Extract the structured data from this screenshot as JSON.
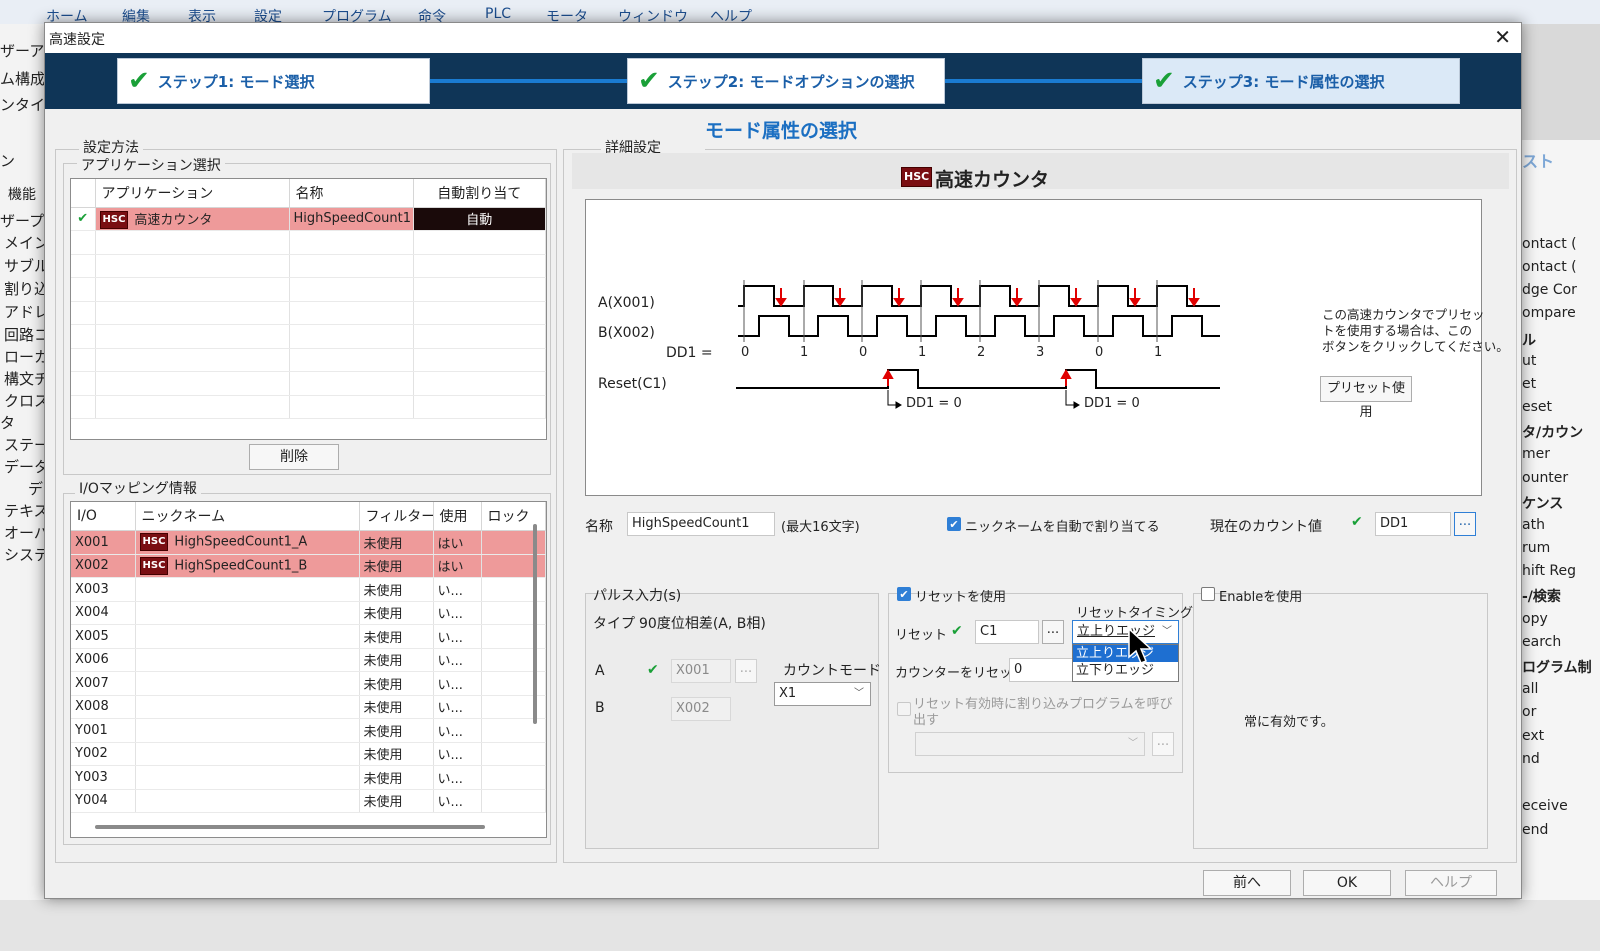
{
  "background": {
    "menu": [
      "ホーム",
      "編集",
      "表示",
      "設定",
      "プログラム",
      "命令",
      "PLC",
      "モータ",
      "ウィンドウ",
      "ヘルプ"
    ],
    "left_items": [
      "ザーアカウ",
      "ム構成",
      "ンタイム",
      "ン",
      "機能",
      "ザープロ",
      "メイン",
      "サブル",
      "割り込",
      "アドレ",
      "回路コ",
      "ローカ",
      "構文チ",
      "クロス",
      "タ",
      "ステー",
      "データ",
      "デ",
      "テキス",
      "オーバ",
      "システ"
    ],
    "right_items": [
      "スト",
      "ontact (",
      "ontact (",
      "dge Cor",
      "ompare",
      "ル",
      "ut",
      "et",
      "eset",
      "タ/カウン",
      "mer",
      "ounter",
      "ケンス",
      "ath",
      "rum",
      "hift Reg",
      "-/検索",
      "opy",
      "earch",
      "ログラム制",
      "all",
      "or",
      "ext",
      "nd",
      "eceive",
      "end"
    ]
  },
  "dialog": {
    "title": "高速設定",
    "close": "✕",
    "steps": [
      "ステップ1:  モード選択",
      "ステップ2:  モードオプションの選択",
      "ステップ3:  モード属性の選択"
    ],
    "heading": "モード属性の選択"
  },
  "left": {
    "setting_method": "設定方法",
    "app_select": "アプリケーション選択",
    "app_headers": [
      "アプリケーション",
      "名称",
      "自動割り当て"
    ],
    "app_row": {
      "check": "✔",
      "icon": "HSC",
      "app": "高速カウンタ",
      "name": "HighSpeedCount1",
      "auto": "自動"
    },
    "delete_btn": "削除",
    "io_title": "I/Oマッピング情報",
    "io_headers": [
      "I/O",
      "ニックネーム",
      "フィルター",
      "使用",
      "ロック"
    ],
    "io_rows": [
      {
        "io": "X001",
        "icon": "HSC",
        "nick": "HighSpeedCount1_A",
        "filter": "未使用",
        "use": "はい",
        "sel": true
      },
      {
        "io": "X002",
        "icon": "HSC",
        "nick": "HighSpeedCount1_B",
        "filter": "未使用",
        "use": "はい",
        "sel": true
      },
      {
        "io": "X003",
        "icon": "",
        "nick": "",
        "filter": "未使用",
        "use": "い...",
        "sel": false
      },
      {
        "io": "X004",
        "icon": "",
        "nick": "",
        "filter": "未使用",
        "use": "い...",
        "sel": false
      },
      {
        "io": "X005",
        "icon": "",
        "nick": "",
        "filter": "未使用",
        "use": "い...",
        "sel": false
      },
      {
        "io": "X006",
        "icon": "",
        "nick": "",
        "filter": "未使用",
        "use": "い...",
        "sel": false
      },
      {
        "io": "X007",
        "icon": "",
        "nick": "",
        "filter": "未使用",
        "use": "い...",
        "sel": false
      },
      {
        "io": "X008",
        "icon": "",
        "nick": "",
        "filter": "未使用",
        "use": "い...",
        "sel": false
      },
      {
        "io": "Y001",
        "icon": "",
        "nick": "",
        "filter": "未使用",
        "use": "い...",
        "sel": false
      },
      {
        "io": "Y002",
        "icon": "",
        "nick": "",
        "filter": "未使用",
        "use": "い...",
        "sel": false
      },
      {
        "io": "Y003",
        "icon": "",
        "nick": "",
        "filter": "未使用",
        "use": "い...",
        "sel": false
      },
      {
        "io": "Y004",
        "icon": "",
        "nick": "",
        "filter": "未使用",
        "use": "い...",
        "sel": false
      }
    ]
  },
  "detail": {
    "title": "詳細設定",
    "icon": "HSC",
    "name": "高速カウンタ",
    "diagram": {
      "a_label": "A(X001)",
      "b_label": "B(X002)",
      "dd1_label": "DD1 =",
      "counts": [
        "0",
        "1",
        "0",
        "1",
        "2",
        "3",
        "0",
        "1"
      ],
      "reset_label": "Reset(C1)",
      "reset_note": "DD1 = 0",
      "preset_text_1": "この高速カウンタでプリセッ",
      "preset_text_2": "トを使用する場合は、この",
      "preset_text_3": "ボタンをクリックしてください。",
      "preset_btn": "プリセット使用"
    },
    "name_label": "名称",
    "name_value": "HighSpeedCount1",
    "name_max": "(最大16文字)",
    "auto_nick": "ニックネームを自動で割り当てる",
    "current_count_label": "現在のカウント値",
    "current_count_value": "DD1",
    "dots": "..."
  },
  "pulse": {
    "title": "パルス入力(s)",
    "type_label": "タイプ",
    "type_value": "90度位相差(A, B相)",
    "a_label": "A",
    "a_value": "X001",
    "b_label": "B",
    "b_value": "X002",
    "count_mode_label": "カウントモード",
    "count_mode_value": "X1"
  },
  "reset": {
    "use_label": "リセットを使用",
    "timing_label": "リセットタイミング",
    "reset_label": "リセット",
    "reset_value": "C1",
    "timing_value": "立上りエッジ",
    "options": [
      "立上りエッジ",
      "立下りエッジ"
    ],
    "counter_reset_label": "カウンターをリセット",
    "counter_reset_value": "0",
    "interrupt_label_1": "リセット有効時に割り込みプログラムを呼び",
    "interrupt_label_2": "出す"
  },
  "enable": {
    "use_label": "Enableを使用",
    "always": "常に有効です。"
  },
  "footer": {
    "prev": "前へ",
    "ok": "OK",
    "help": "ヘルプ"
  }
}
